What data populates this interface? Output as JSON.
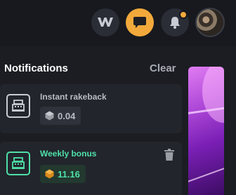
{
  "header": {
    "buttons": [
      {
        "icon": "brand-logo-icon"
      },
      {
        "icon": "chat-icon",
        "active": true,
        "color": "#f2a93b"
      },
      {
        "icon": "bell-icon",
        "has_indicator": true
      },
      {
        "icon": "avatar"
      }
    ]
  },
  "notifications": {
    "title": "Notifications",
    "clear_label": "Clear",
    "items": [
      {
        "title": "Instant rakeback",
        "amount": "0.04",
        "icon": "cash-register-icon",
        "coin": "silver-coin-icon",
        "accent": "#b8bbc3"
      },
      {
        "title": "Weekly bonus",
        "amount": "11.16",
        "icon": "cash-register-icon",
        "coin": "gold-coin-icon",
        "accent": "#4fe0a8",
        "deletable": true
      }
    ]
  },
  "colors": {
    "background": "#1b1d22",
    "topbar": "#17191e",
    "card": "#22252c",
    "accent_orange": "#f2a93b",
    "accent_green": "#4fe0a8",
    "promo_purple": "#b04ad9"
  }
}
